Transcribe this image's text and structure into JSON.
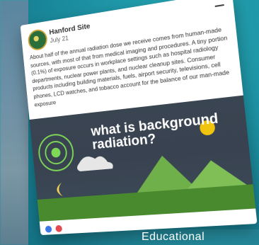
{
  "background": {
    "left_color": "#6d91a6",
    "right_color": "#1d94a6"
  },
  "footer_caption": "Educational",
  "post": {
    "author": "Hanford Site",
    "date": "July 21",
    "menu_icon": "minus-icon",
    "text": "About half of the annual radiation dose we receive comes from human-made sources, with most of that from medical imaging and procedures. A tiny portion (0.1%) of exposure occurs in workplace settings such as hospital radiology departments, nuclear power plants, and nuclear cleanup sites. Consumer products including building materials, fuels, airport security, televisions, cell phones, LCD watches, and tobacco account for the balance of our man-made exposure",
    "graphic_title": "what is background radiation?",
    "reactions": [
      "like",
      "love"
    ]
  }
}
